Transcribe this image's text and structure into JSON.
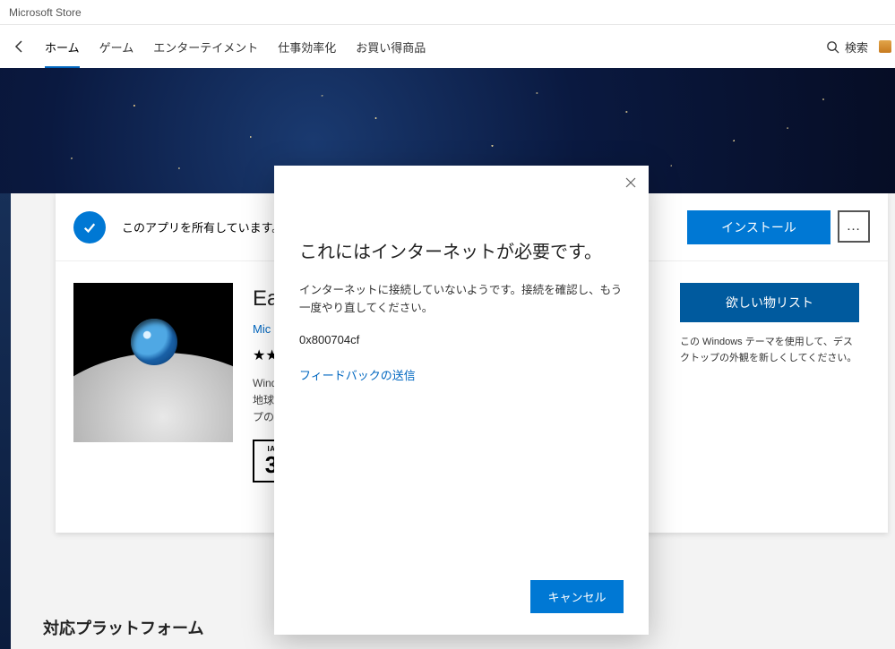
{
  "window": {
    "title": "Microsoft Store"
  },
  "nav": {
    "tabs": [
      "ホーム",
      "ゲーム",
      "エンターテイメント",
      "仕事効率化",
      "お買い得商品"
    ],
    "active_index": 0,
    "search_label": "検索"
  },
  "own_bar": {
    "label": "このアプリを所有しています。",
    "install_label": "インストール",
    "more_label": "…"
  },
  "app": {
    "name_visible": "Ea",
    "publisher_visible": "Mic",
    "rating_stars_visible": "★★",
    "description_visible_lines": [
      "Wind",
      "地球",
      "プの壁"
    ],
    "iarc": {
      "top": "IA",
      "number": "3"
    }
  },
  "sidebar": {
    "wishlist_label": "欲しい物リスト",
    "theme_hint": "この Windows テーマを使用して、デスクトップの外観を新しくしてください。"
  },
  "section": {
    "platforms_title": "対応プラットフォーム"
  },
  "dialog": {
    "title": "これにはインターネットが必要です。",
    "message": "インターネットに接続していないようです。接続を確認し、もう一度やり直してください。",
    "error_code": "0x800704cf",
    "feedback_link": "フィードバックの送信",
    "cancel_label": "キャンセル"
  }
}
